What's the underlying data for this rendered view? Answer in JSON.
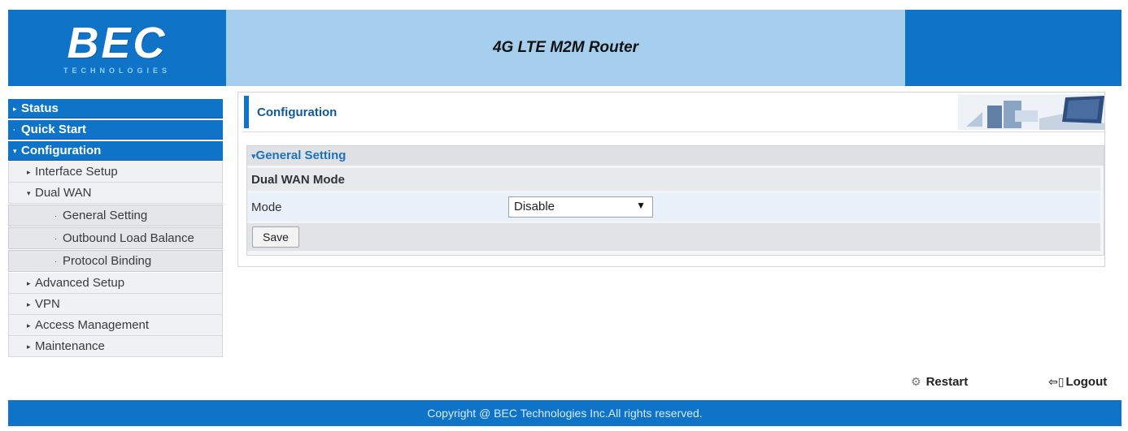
{
  "header": {
    "logo": "BEC",
    "logo_sub": "TECHNOLOGIES",
    "title": "4G LTE M2M Router"
  },
  "sidebar": {
    "items": [
      {
        "label": "Status",
        "marker": "▸"
      },
      {
        "label": "Quick Start",
        "marker": "·"
      },
      {
        "label": "Configuration",
        "marker": "▾"
      },
      {
        "label": "Interface Setup",
        "marker": "▸"
      },
      {
        "label": "Dual WAN",
        "marker": "▾"
      },
      {
        "label": "General Setting",
        "marker": "·"
      },
      {
        "label": "Outbound Load Balance",
        "marker": "·"
      },
      {
        "label": "Protocol Binding",
        "marker": "·"
      },
      {
        "label": "Advanced Setup",
        "marker": "▸"
      },
      {
        "label": "VPN",
        "marker": "▸"
      },
      {
        "label": "Access Management",
        "marker": "▸"
      },
      {
        "label": "Maintenance",
        "marker": "▸"
      }
    ]
  },
  "main": {
    "page_title": "Configuration",
    "section_title": "General Setting",
    "section_marker": "▾",
    "group_title": "Dual WAN Mode",
    "mode_label": "Mode",
    "mode_value": "Disable",
    "mode_caret": "▼",
    "save_label": "Save"
  },
  "actions": {
    "restart_label": "Restart",
    "logout_label": "Logout"
  },
  "footer": {
    "copyright": "Copyright @ BEC Technologies Inc.All rights reserved."
  },
  "colors": {
    "brand_blue": "#0f74c8",
    "title_band": "#a6cfee"
  }
}
